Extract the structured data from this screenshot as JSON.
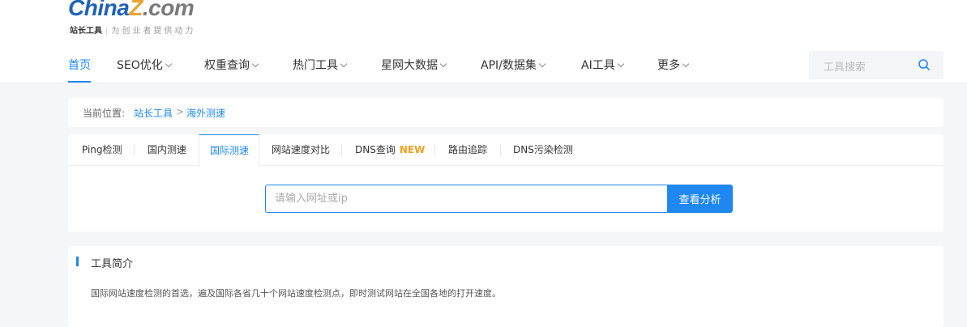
{
  "logo": {
    "china": "China",
    "z": "Z",
    "com": ".com",
    "brand": "站长工具",
    "slogan": "为创业者提供动力"
  },
  "nav": {
    "items": [
      {
        "label": "首页",
        "active": true
      },
      {
        "label": "SEO优化"
      },
      {
        "label": "权重查询"
      },
      {
        "label": "热门工具"
      },
      {
        "label": "星网大数据"
      },
      {
        "label": "API/数据集"
      },
      {
        "label": "AI工具"
      },
      {
        "label": "更多"
      }
    ]
  },
  "search": {
    "placeholder": "工具搜索",
    "icon": "search-icon"
  },
  "breadcrumb": {
    "label": "当前位置:",
    "items": [
      "站长工具",
      "海外测速"
    ],
    "separator": ">"
  },
  "tabs": [
    {
      "label": "Ping检测"
    },
    {
      "label": "国内测速"
    },
    {
      "label": "国际测速",
      "active": true
    },
    {
      "label": "网站速度对比"
    },
    {
      "label": "DNS查询",
      "badge": "NEW"
    },
    {
      "label": "路由追踪"
    },
    {
      "label": "DNS污染检测"
    }
  ],
  "query": {
    "placeholder": "请输入网址或ip",
    "button": "查看分析"
  },
  "intro": {
    "title": "工具简介",
    "desc": "国际网站速度检测的首选，遍及国际各省几十个网站速度检测点，即时测试网站在全国各地的打开速度。"
  },
  "colors": {
    "accent": "#1e87f0",
    "badge": "#f0a020"
  }
}
